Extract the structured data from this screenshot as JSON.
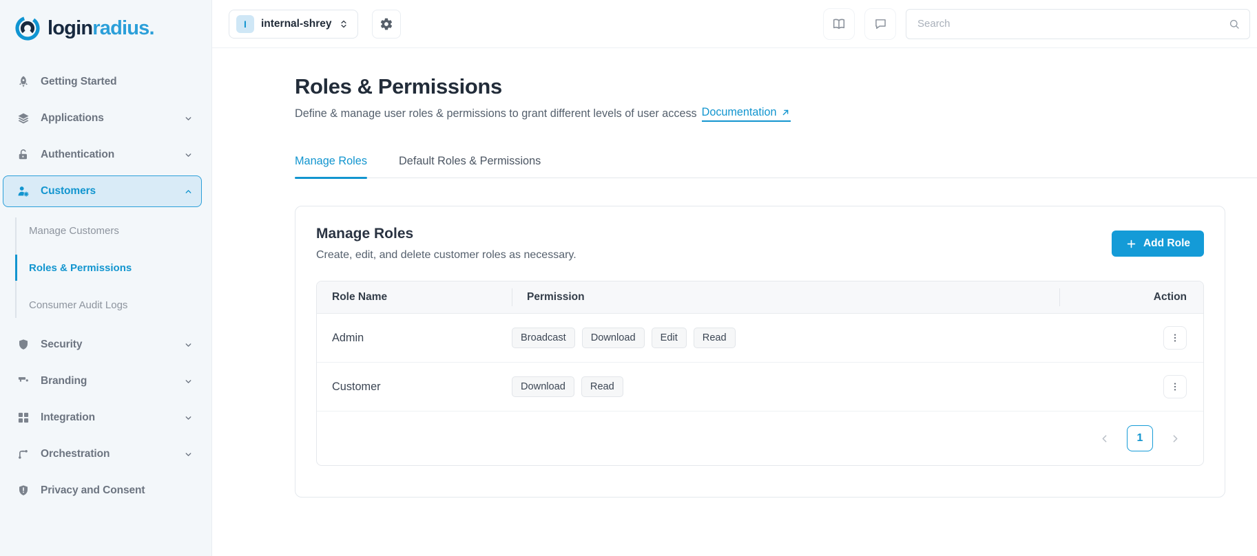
{
  "brand": {
    "part1": "login",
    "part2": "radius."
  },
  "colors": {
    "accent": "#149bd7",
    "link": "#1295cf",
    "sidebar_active_bg": "#d9ebf7",
    "brand_navy": "#17293f"
  },
  "topbar": {
    "app_badge": "I",
    "app_name": "internal-shrey",
    "search_placeholder": "Search"
  },
  "sidebar": {
    "items": [
      {
        "label": "Getting Started",
        "icon": "rocket"
      },
      {
        "label": "Applications",
        "icon": "layers"
      },
      {
        "label": "Authentication",
        "icon": "lock-open"
      },
      {
        "label": "Customers",
        "icon": "user-gear",
        "active": true
      },
      {
        "label": "Security",
        "icon": "shield"
      },
      {
        "label": "Branding",
        "icon": "paint-roller"
      },
      {
        "label": "Integration",
        "icon": "grid"
      },
      {
        "label": "Orchestration",
        "icon": "git-branch"
      },
      {
        "label": "Privacy and Consent",
        "icon": "shield-alert"
      }
    ],
    "customers_submenu": [
      {
        "label": "Manage Customers"
      },
      {
        "label": "Roles & Permissions",
        "active": true
      },
      {
        "label": "Consumer Audit Logs"
      }
    ]
  },
  "page": {
    "title": "Roles & Permissions",
    "subtitle": "Define & manage user roles & permissions to grant different levels of user access",
    "doc_link_label": "Documentation",
    "tabs": [
      {
        "label": "Manage Roles",
        "active": true
      },
      {
        "label": "Default Roles & Permissions"
      }
    ]
  },
  "card": {
    "title": "Manage Roles",
    "subtitle": "Create, edit, and delete customer roles as necessary.",
    "add_button_label": "Add Role"
  },
  "table": {
    "headers": [
      "Role Name",
      "Permission",
      "Action"
    ],
    "rows": [
      {
        "role": "Admin",
        "permissions": [
          "Broadcast",
          "Download",
          "Edit",
          "Read"
        ]
      },
      {
        "role": "Customer",
        "permissions": [
          "Download",
          "Read"
        ]
      }
    ],
    "pagination": {
      "current_page": "1"
    }
  }
}
